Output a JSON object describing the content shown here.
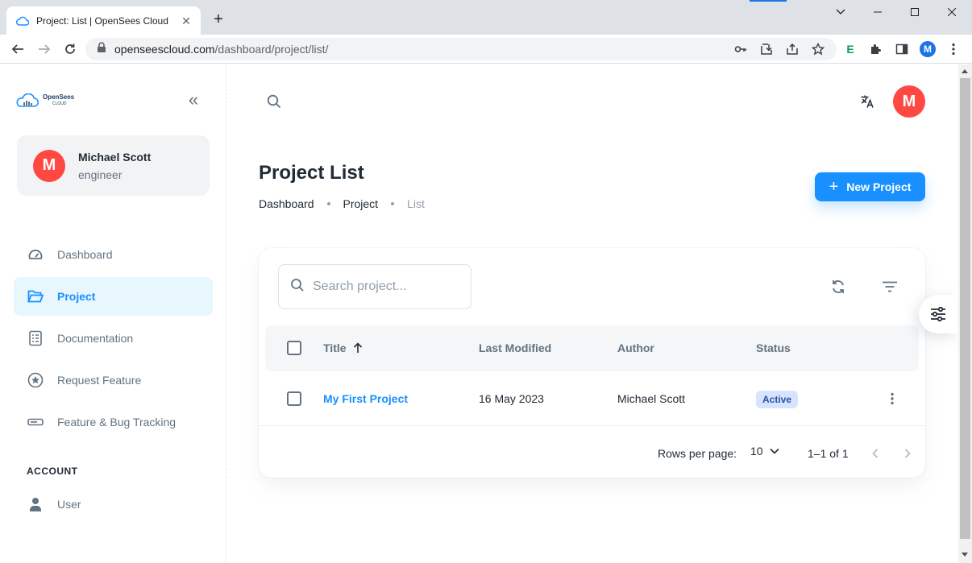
{
  "browser": {
    "tab_title": "Project: List | OpenSees Cloud",
    "url_host": "openseescloud.com",
    "url_path": "/dashboard/project/list/",
    "profile_initial": "M",
    "extension_letter": "E"
  },
  "sidebar": {
    "logo_text_line1": "OpenSees",
    "logo_text_line2": "CLOUD",
    "user": {
      "initial": "M",
      "name": "Michael Scott",
      "role": "engineer"
    },
    "items": [
      {
        "label": "Dashboard",
        "icon": "dashboard-icon"
      },
      {
        "label": "Project",
        "icon": "folder-open-icon",
        "active": true
      },
      {
        "label": "Documentation",
        "icon": "document-icon"
      },
      {
        "label": "Request Feature",
        "icon": "star-circle-icon"
      },
      {
        "label": "Feature & Bug Tracking",
        "icon": "tracking-icon"
      }
    ],
    "account_header": "ACCOUNT",
    "account_items": [
      {
        "label": "User",
        "icon": "user-icon"
      }
    ]
  },
  "header": {
    "avatar_initial": "M"
  },
  "main": {
    "title": "Project List",
    "breadcrumb": [
      "Dashboard",
      "Project",
      "List"
    ],
    "new_project_label": "New Project",
    "search_placeholder": "Search project...",
    "table": {
      "columns": [
        "Title",
        "Last Modified",
        "Author",
        "Status"
      ],
      "sort_column": "Title",
      "rows": [
        {
          "title": "My First Project",
          "last_modified": "16 May 2023",
          "author": "Michael Scott",
          "status": "Active"
        }
      ]
    },
    "pagination": {
      "rows_per_page_label": "Rows per page:",
      "rows_per_page": "10",
      "range": "1–1 of 1"
    }
  },
  "colors": {
    "primary": "#1890ff",
    "avatar": "#ff4842",
    "active_bg": "#e8f6fd",
    "badge_bg": "#d6e4ff"
  }
}
